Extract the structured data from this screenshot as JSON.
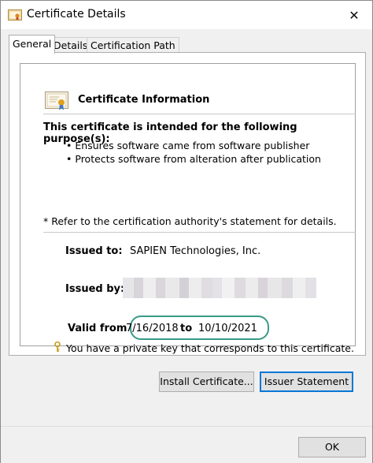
{
  "window": {
    "title": "Certificate Details",
    "close_glyph": "✕"
  },
  "tabs": [
    {
      "label": "General",
      "active": true
    },
    {
      "label": "Details",
      "active": false
    },
    {
      "label": "Certification Path",
      "active": false
    }
  ],
  "certificate": {
    "heading": "Certificate Information",
    "purpose_heading": "This certificate is intended for the following purpose(s):",
    "purposes": [
      "Ensures software came from software publisher",
      "Protects software from alteration after publication"
    ],
    "note": "* Refer to the certification authority's statement for details.",
    "issued_to_label": "Issued to:",
    "issued_to_value": "SAPIEN Technologies, Inc.",
    "issued_by_label": "Issued by:",
    "valid_from_label": "Valid from",
    "valid_from": "7/16/2018",
    "to_label": "to",
    "valid_to": "10/10/2021",
    "private_key_note": "You have a private key that corresponds to this certificate."
  },
  "buttons": {
    "install": "Install Certificate...",
    "issuer_statement": "Issuer Statement",
    "ok": "OK"
  },
  "icons": {
    "title": "certificate-icon",
    "info": "certificate-icon",
    "key": "key-icon",
    "close": "close-icon"
  },
  "colors": {
    "highlight": "#3a9a86",
    "default_button_border": "#0078d7"
  }
}
